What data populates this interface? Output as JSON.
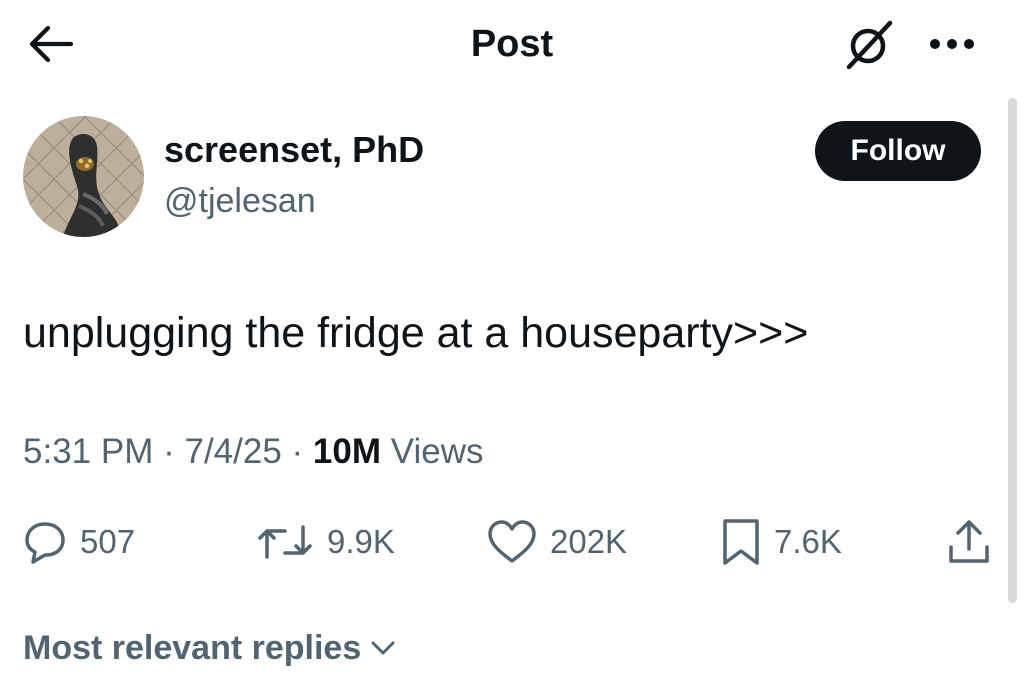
{
  "header": {
    "title": "Post",
    "back_icon": "arrow-left-icon",
    "grok_icon": "grok-icon",
    "more_icon": "more-dots-icon"
  },
  "author": {
    "display_name": "screenset, PhD",
    "handle": "@tjelesan",
    "follow_label": "Follow"
  },
  "post": {
    "text": "unplugging the fridge at a houseparty>>>",
    "time": "5:31 PM",
    "date": "7/4/25",
    "views_count": "10M",
    "views_label": "Views",
    "separator": "·"
  },
  "actions": {
    "replies": "507",
    "reposts": "9.9K",
    "likes": "202K",
    "bookmarks": "7.6K"
  },
  "replies_sort": {
    "label": "Most relevant replies"
  },
  "colors": {
    "text": "#0f1419",
    "secondary": "#536471",
    "follow_bg": "#0f1419",
    "background": "#ffffff"
  }
}
